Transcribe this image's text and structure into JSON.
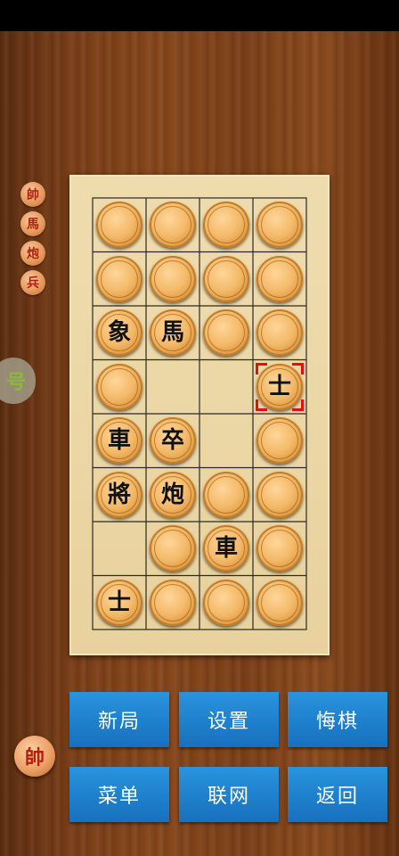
{
  "captured": [
    "帥",
    "馬",
    "炮",
    "兵"
  ],
  "float_tab_glyph": "号",
  "board": {
    "cols": 4,
    "rows": 8,
    "selected": {
      "row": 3,
      "col": 3
    },
    "cells": [
      [
        "",
        "",
        "",
        ""
      ],
      [
        "",
        "",
        "",
        ""
      ],
      [
        "象",
        "馬",
        "",
        ""
      ],
      [
        "",
        null,
        null,
        "士"
      ],
      [
        "車",
        "卒",
        null,
        ""
      ],
      [
        "將",
        "炮",
        "",
        ""
      ],
      [
        null,
        "",
        "車",
        ""
      ],
      [
        "士",
        "",
        "",
        ""
      ]
    ]
  },
  "buttons": {
    "new_game": "新局",
    "settings": "设置",
    "undo": "悔棋",
    "menu": "菜单",
    "online": "联网",
    "back": "返回"
  },
  "turn_indicator": "帥",
  "colors": {
    "selection": "#e01010",
    "button": "#1e80cc",
    "red_glyph": "#b3200e"
  }
}
